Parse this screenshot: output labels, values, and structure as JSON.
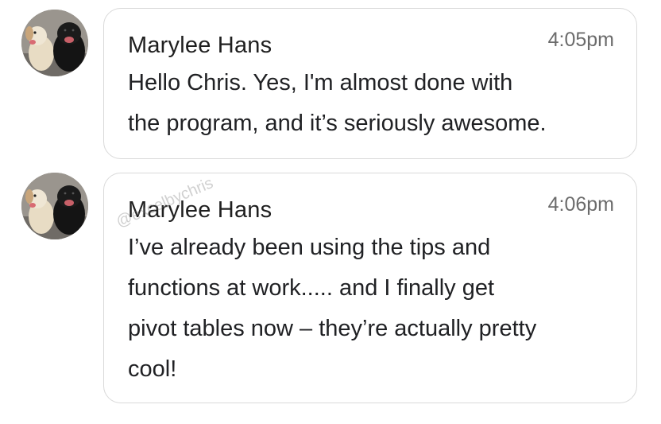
{
  "messages": [
    {
      "sender": "Marylee Hans",
      "time": "4:05pm",
      "text": "Hello Chris. Yes, I'm almost done with\nthe program, and it’s seriously awesome.",
      "avatar_icon": "dogs-photo-avatar"
    },
    {
      "sender": "Marylee Hans",
      "time": "4:06pm",
      "text": "I’ve already been using the tips and\nfunctions at work..... and I finally get\npivot tables now – they’re actually pretty\ncool!",
      "avatar_icon": "dogs-photo-avatar"
    }
  ],
  "watermark": "@excelbychris",
  "colors": {
    "bubble_border": "#d9d9d9",
    "timestamp": "#6b6b6b",
    "text": "#202124"
  }
}
